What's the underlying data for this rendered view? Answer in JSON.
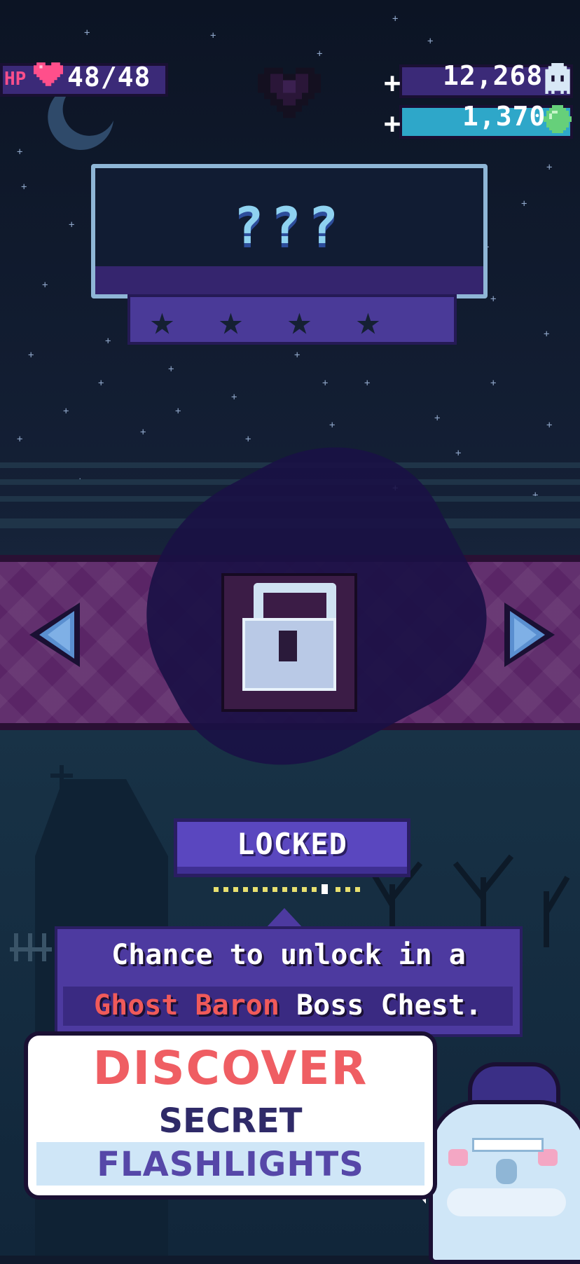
{
  "hud": {
    "hp_label": "HP",
    "hp_value": "48/48",
    "ghosts_value": "12,268",
    "gems_value": "1,370",
    "plus": "+"
  },
  "flashlight": {
    "name": "???",
    "stars_total": 4,
    "status": "LOCKED",
    "page_count": 15,
    "page_current": 11
  },
  "info": {
    "line1": "Chance to unlock in a",
    "line2_highlight": "Ghost Baron",
    "line2_rest": "Boss Chest."
  },
  "promo": {
    "line1": "DISCOVER",
    "line2": "SECRET",
    "line3": "FLASHLIGHTS"
  },
  "colors": {
    "hp_pink": "#ff4f8b",
    "highlight_red": "#f05a5a",
    "accent_purple": "#5a47bf",
    "gem_green": "#66d07a"
  },
  "icons": {
    "hp": "heart-icon",
    "ghost": "ghost-icon",
    "gem": "gem-icon",
    "center": "heart-outline-icon",
    "lock": "padlock-icon"
  }
}
